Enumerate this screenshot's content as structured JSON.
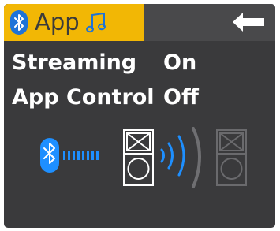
{
  "header": {
    "tab_label": "App",
    "tab_color": "#f2b705",
    "tab_icons": [
      "bluetooth-icon",
      "music-note-icon"
    ],
    "back_icon": "arrow-left-icon"
  },
  "settings": [
    {
      "label": "Streaming",
      "value": "On"
    },
    {
      "label": "App Control",
      "value": "Off"
    }
  ],
  "diagram": {
    "icons": [
      "bluetooth-icon",
      "speaker-icon",
      "signal-waves-icon",
      "speaker-icon"
    ],
    "accent_color": "#1e90ff"
  }
}
